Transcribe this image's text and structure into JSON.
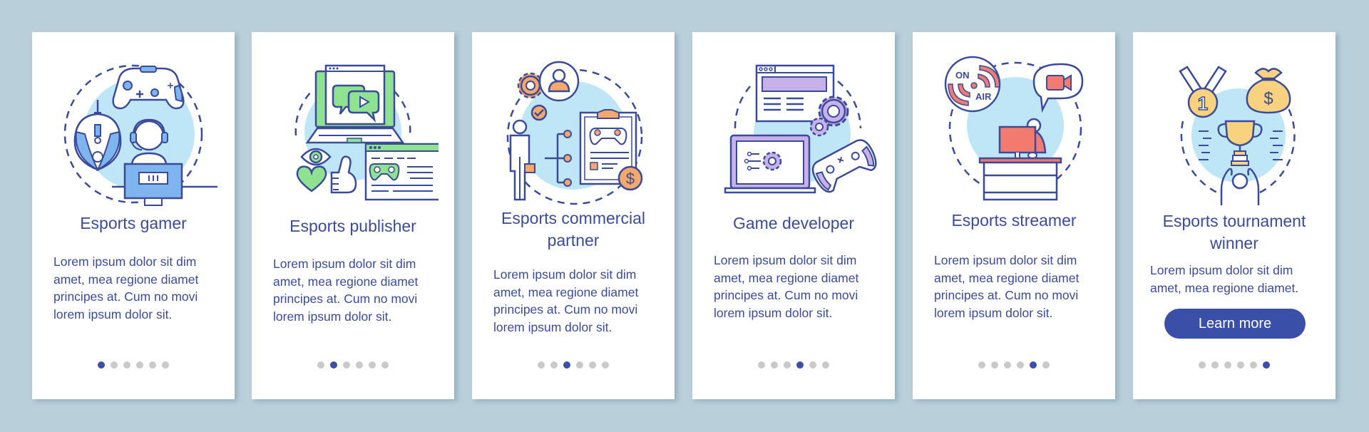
{
  "colors": {
    "background": "#b9cfda",
    "card": "#ffffff",
    "text": "#3b4b9a",
    "stroke": "#3b4b9a",
    "circle": "#bfe6f7",
    "dot_inactive": "#c9c9cc",
    "dot_active": "#3a4fa8",
    "button": "#3a4fa8",
    "accent_gamer": "#7fb5ee",
    "accent_publisher": "#8fe28f",
    "accent_partner": "#f4a86c",
    "accent_developer": "#c8b0ea",
    "accent_streamer": "#f27a6e",
    "accent_winner": "#f8d27e"
  },
  "cards": [
    {
      "title": "Esports gamer",
      "body": "Lorem ipsum dolor sit dim amet, mea regione diamet principes at. Cum no movi lorem ipsum dolor sit.",
      "icon": "esports-gamer-illustration",
      "active_step": 1,
      "total_steps": 6
    },
    {
      "title": "Esports publisher",
      "body": "Lorem ipsum dolor sit dim amet, mea regione diamet principes at. Cum no movi lorem ipsum dolor sit.",
      "icon": "esports-publisher-illustration",
      "active_step": 2,
      "total_steps": 6
    },
    {
      "title": "Esports commercial partner",
      "body": "Lorem ipsum dolor sit dim amet, mea regione diamet principes at. Cum no movi lorem ipsum dolor sit.",
      "icon": "commercial-partner-illustration",
      "active_step": 3,
      "total_steps": 6
    },
    {
      "title": "Game developer",
      "body": "Lorem ipsum dolor sit dim amet, mea regione diamet principes at. Cum no movi lorem ipsum dolor sit.",
      "icon": "game-developer-illustration",
      "active_step": 4,
      "total_steps": 6
    },
    {
      "title": "Esports streamer",
      "body": "Lorem ipsum dolor sit dim amet, mea regione diamet principes at. Cum no movi lorem ipsum dolor sit.",
      "icon": "esports-streamer-illustration",
      "active_step": 5,
      "total_steps": 6
    },
    {
      "title": "Esports tournament winner",
      "body": "Lorem ipsum dolor sit dim amet, mea regione diamet.",
      "icon": "tournament-winner-illustration",
      "active_step": 6,
      "total_steps": 6,
      "button_label": "Learn more"
    }
  ],
  "illustration_labels": {
    "on": "ON",
    "air": "AIR",
    "medal_number": "1",
    "currency": "$"
  }
}
